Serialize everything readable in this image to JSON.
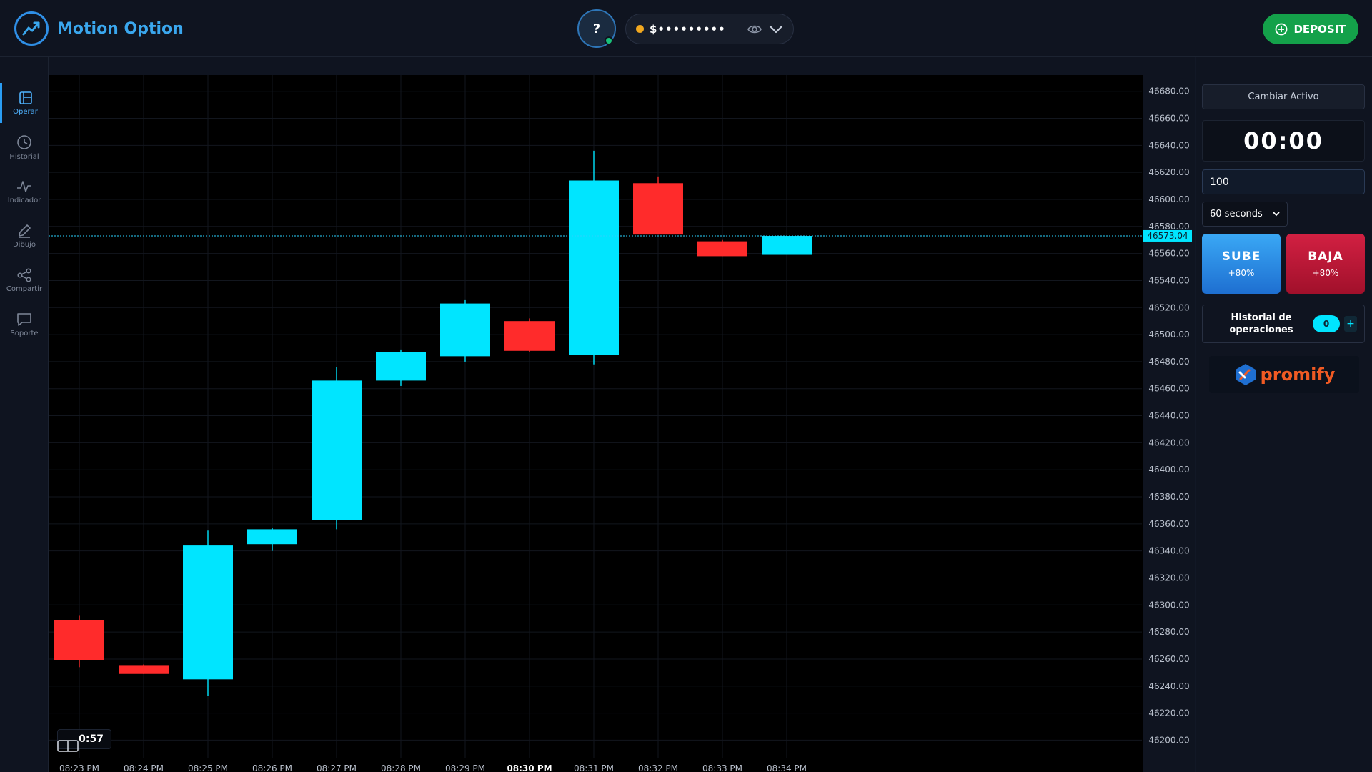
{
  "header": {
    "brand": "Motion Option",
    "help_label": "?",
    "balance_masked": "$•••••••••",
    "deposit_label": "DEPOSIT"
  },
  "sidebar": {
    "items": [
      {
        "label": "Operar",
        "icon": "layout-icon",
        "active": true
      },
      {
        "label": "Historial",
        "icon": "clock-icon",
        "active": false
      },
      {
        "label": "Indicador",
        "icon": "pulse-icon",
        "active": false
      },
      {
        "label": "Dibujo",
        "icon": "pencil-icon",
        "active": false
      },
      {
        "label": "Compartir",
        "icon": "share-icon",
        "active": false
      },
      {
        "label": "Soporte",
        "icon": "chat-icon",
        "active": false
      }
    ]
  },
  "panel": {
    "change_asset_label": "Cambiar Activo",
    "countdown": "00:00",
    "amount_value": "100",
    "duration_selected": "60 seconds",
    "sube": {
      "label": "SUBE",
      "payout": "+80%"
    },
    "baja": {
      "label": "BAJA",
      "payout": "+80%"
    },
    "history_label": "Historial de operaciones",
    "history_count": "0",
    "history_add": "+",
    "promo_brand": "promify"
  },
  "chart_bottom": {
    "candle_timer": "0:57"
  },
  "colors": {
    "up": "#00e5ff",
    "down": "#ff2b2b",
    "accent": "#2a9df4",
    "deposit": "#14a14a"
  },
  "chart_data": {
    "type": "candlestick",
    "x_labels": [
      "08:23 PM",
      "08:24 PM",
      "08:25 PM",
      "08:26 PM",
      "08:27 PM",
      "08:28 PM",
      "08:29 PM",
      "08:30 PM",
      "08:31 PM",
      "08:32 PM",
      "08:33 PM",
      "08:34 PM"
    ],
    "highlight_label": "08:30 PM",
    "y_ticks": [
      46680,
      46660,
      46640,
      46620,
      46600,
      46580,
      46560,
      46540,
      46520,
      46500,
      46480,
      46460,
      46440,
      46420,
      46400,
      46380,
      46360,
      46340,
      46320,
      46300,
      46280,
      46260,
      46240,
      46220,
      46200
    ],
    "y_range": [
      46187,
      46692
    ],
    "current_price": "46573.04",
    "current_value": 46573.04,
    "candles": [
      {
        "time": "08:23 PM",
        "open": 46289,
        "high": 46292,
        "low": 46254,
        "close": 46259
      },
      {
        "time": "08:24 PM",
        "open": 46255,
        "high": 46256,
        "low": 46249,
        "close": 46249
      },
      {
        "time": "08:25 PM",
        "open": 46245,
        "high": 46355,
        "low": 46233,
        "close": 46344
      },
      {
        "time": "08:26 PM",
        "open": 46345,
        "high": 46357,
        "low": 46340,
        "close": 46356
      },
      {
        "time": "08:27 PM",
        "open": 46363,
        "high": 46476,
        "low": 46356,
        "close": 46466
      },
      {
        "time": "08:28 PM",
        "open": 46466,
        "high": 46489,
        "low": 46462,
        "close": 46487
      },
      {
        "time": "08:29 PM",
        "open": 46484,
        "high": 46526,
        "low": 46480,
        "close": 46523
      },
      {
        "time": "08:30 PM",
        "open": 46510,
        "high": 46512,
        "low": 46487,
        "close": 46488
      },
      {
        "time": "08:31 PM",
        "open": 46485,
        "high": 46636,
        "low": 46478,
        "close": 46614
      },
      {
        "time": "08:32 PM",
        "open": 46612,
        "high": 46617,
        "low": 46574,
        "close": 46574
      },
      {
        "time": "08:33 PM",
        "open": 46569,
        "high": 46570,
        "low": 46558,
        "close": 46558
      },
      {
        "time": "08:34 PM",
        "open": 46559,
        "high": 46573,
        "low": 46559,
        "close": 46573
      }
    ]
  }
}
